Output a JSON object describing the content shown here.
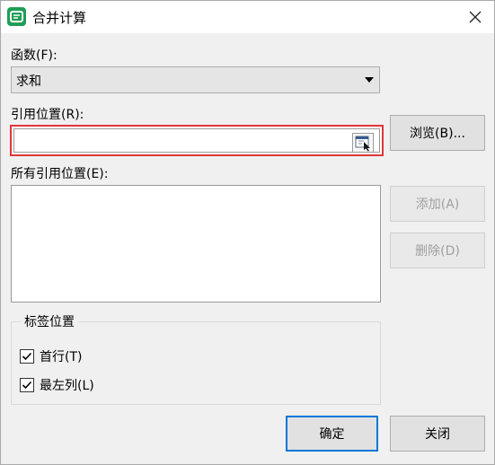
{
  "window": {
    "title": "合并计算",
    "app_icon_letter": "S",
    "close_symbol": "✕"
  },
  "function_field": {
    "label": "函数(F):",
    "selected_value": "求和"
  },
  "reference_field": {
    "label": "引用位置(R):",
    "value": ""
  },
  "all_references": {
    "label": "所有引用位置(E):",
    "items": []
  },
  "buttons": {
    "browse": "浏览(B)...",
    "add": "添加(A)",
    "delete": "删除(D)",
    "ok": "确定",
    "close": "关闭"
  },
  "label_position": {
    "group_title": "标签位置",
    "first_row": {
      "label": "首行(T)",
      "checked": true
    },
    "left_column": {
      "label": "最左列(L)",
      "checked": true
    }
  },
  "colors": {
    "highlight_border": "#e0363a",
    "app_icon": "#1f9d55",
    "primary_border": "#0078d7"
  }
}
